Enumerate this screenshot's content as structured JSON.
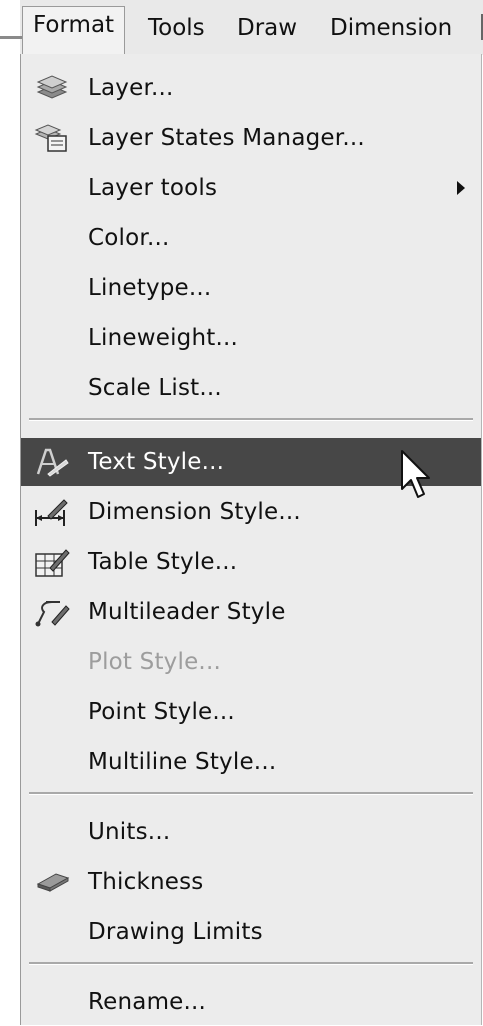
{
  "menubar": {
    "items": [
      {
        "label": "Format",
        "active": true
      },
      {
        "label": "Tools"
      },
      {
        "label": "Draw"
      },
      {
        "label": "Dimension"
      }
    ]
  },
  "format_menu": {
    "items": [
      {
        "label": "Layer...",
        "icon": "layers-icon"
      },
      {
        "label": "Layer States Manager...",
        "icon": "layer-states-icon"
      },
      {
        "label": "Layer tools",
        "has_submenu": true
      },
      {
        "label": "Color..."
      },
      {
        "label": "Linetype..."
      },
      {
        "label": "Lineweight..."
      },
      {
        "label": "Scale List..."
      },
      {
        "label": "Text Style...",
        "icon": "text-style-icon",
        "highlighted": true
      },
      {
        "label": "Dimension Style...",
        "icon": "dimension-style-icon"
      },
      {
        "label": "Table Style...",
        "icon": "table-style-icon"
      },
      {
        "label": "Multileader Style",
        "icon": "multileader-style-icon"
      },
      {
        "label": "Plot Style...",
        "disabled": true
      },
      {
        "label": "Point Style..."
      },
      {
        "label": "Multiline Style..."
      },
      {
        "label": "Units..."
      },
      {
        "label": "Thickness",
        "icon": "thickness-icon"
      },
      {
        "label": "Drawing Limits"
      },
      {
        "label": "Rename..."
      }
    ]
  },
  "colors": {
    "menu_background": "#ececec",
    "highlight": "#474747",
    "disabled_text": "#9d9d9d"
  }
}
